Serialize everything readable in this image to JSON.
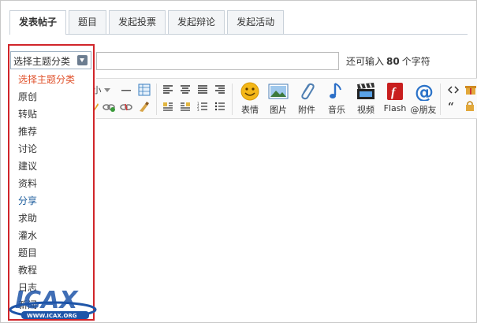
{
  "tabs": [
    {
      "label": "发表帖子",
      "active": true
    },
    {
      "label": "题目"
    },
    {
      "label": "发起投票"
    },
    {
      "label": "发起辩论"
    },
    {
      "label": "发起活动"
    }
  ],
  "subject": {
    "category_select": "选择主题分类",
    "remain_prefix": "还可输入",
    "remain_count": "80",
    "remain_suffix": "个字符"
  },
  "categories": [
    "选择主题分类",
    "原创",
    "转贴",
    "推荐",
    "讨论",
    "建议",
    "资料",
    "分享",
    "求助",
    "灌水",
    "题目",
    "教程",
    "日志",
    "新闻"
  ],
  "toolbar": {
    "font_size_label": "小",
    "buttons": [
      "表情",
      "图片",
      "附件",
      "音乐",
      "视频",
      "Flash",
      "@朋友"
    ]
  },
  "watermark": {
    "text": "ICAX",
    "url": "WWW.ICAX.ORG"
  },
  "colors": {
    "highlight": "#d1252a",
    "tab_border": "#c9d1d9",
    "first_item": "#e0522c"
  }
}
